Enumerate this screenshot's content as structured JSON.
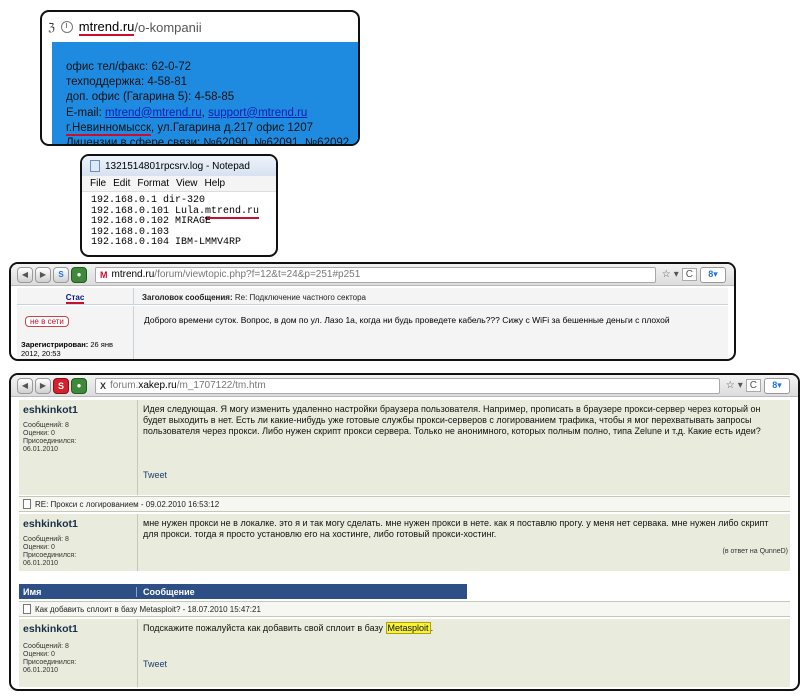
{
  "frame1": {
    "url_host": "mtrend.ru",
    "url_path": "/o-kompanii",
    "lines": {
      "phone": "офис тел/факс: 62-0-72",
      "support": "техподдержка: 4-58-81",
      "extra_office": "доп. офис (Гагарина 5): 4-58-85",
      "email_label": "E-mail: ",
      "email1": "mtrend@mtrend.ru",
      "email_sep": ", ",
      "email2": "support@mtrend.ru",
      "city": "г.Невинномысск",
      "street": ", ул.Гагарина д.217 офис 1207",
      "licenses": "Лицензии в сфере связи: №62090, №62091, №62092"
    }
  },
  "notepad": {
    "title": "1321514801rpcsrv.log - Notepad",
    "menu": [
      "File",
      "Edit",
      "Format",
      "View",
      "Help"
    ],
    "lines": [
      "192.168.0.1 dir-320",
      "192.168.0.101 Lula.",
      "mtrend.ru",
      "192.168.0.102 MIRAGE",
      "192.168.0.103",
      "192.168.0.104 IBM-LMMV4RP"
    ]
  },
  "forum_mtrend": {
    "url_host": "mtrend.ru",
    "url_path": "/forum/viewtopic.php?f=12&t=24&p=251#p251",
    "author": "Стас",
    "subject_label": "Заголовок сообщения: ",
    "subject": "Re: Подключение частного сектора",
    "status": "не в сети",
    "registered_label": "Зарегистрирован: ",
    "registered_date": "26 янв 2012, 20:53",
    "message": "Доброго времени суток. Вопрос, в дом по ул. Лазо 1а, когда ни будь проведете кабель??? Сижу с WiFi за бешенные деньги с плохой"
  },
  "forum_xakep": {
    "url_prefix": "forum.",
    "url_host": "xakep.ru",
    "url_path": "/m_1707122/tm.htm",
    "post1": {
      "author": "eshkinkot1",
      "meta": [
        "Сообщений: 8",
        "Оценки: 0",
        "Присоединился:",
        "06.01.2010"
      ],
      "text": "Идея следующая. Я могу изменить удаленно настройки браузера пользователя. Например, прописать в браузере прокси-сервер через который он будет выходить в нет. Есть ли какие-нибудь уже готовые службы прокси-серверов с логированием трафика, чтобы я мог перехватывать запросы пользователя через прокси. Либо нужен скрипт прокси сервера. Только не анонимного, которых полным полно, типа Zelune и т.д. Какие есть идеи?",
      "tweet": "Tweet"
    },
    "subject1": "RE: Прокси с логированием - 09.02.2010 16:53:12",
    "post2": {
      "author": "eshkinkot1",
      "meta": [
        "Сообщений: 8",
        "Оценки: 0",
        "Присоединился:",
        "06.01.2010"
      ],
      "text": "мне нужен прокси не в локалке. это я и так могу сделать. мне нужен прокси в нете. как я поставлю прогу. у меня нет сервака. мне нужен либо скрипт для прокси. тогда я просто установлю его на хостинге, либо готовый прокси-хостинг.",
      "reply_note": "(в ответ на QunneD)"
    },
    "table_head": {
      "name": "Имя",
      "message": "Сообщение"
    },
    "subject2": "Как добавить сплоит в базу Metasploit? - 18.07.2010 15:47:21",
    "post3": {
      "author": "eshkinkot1",
      "meta": [
        "Сообщений: 8",
        "Оценки: 0",
        "Присоединился:",
        "06.01.2010"
      ],
      "text_before": "Подскажите пожалуйста как добавить свой сплоит в базу ",
      "highlight": "Metasploit",
      "text_after": ".",
      "tweet": "Tweet"
    }
  },
  "colors": {
    "accent_red": "#c8102e",
    "contact_blue": "#1f8be0",
    "post_bg": "#e9ecdc",
    "table_header": "#2e4f86",
    "highlight": "#f6f33a"
  }
}
